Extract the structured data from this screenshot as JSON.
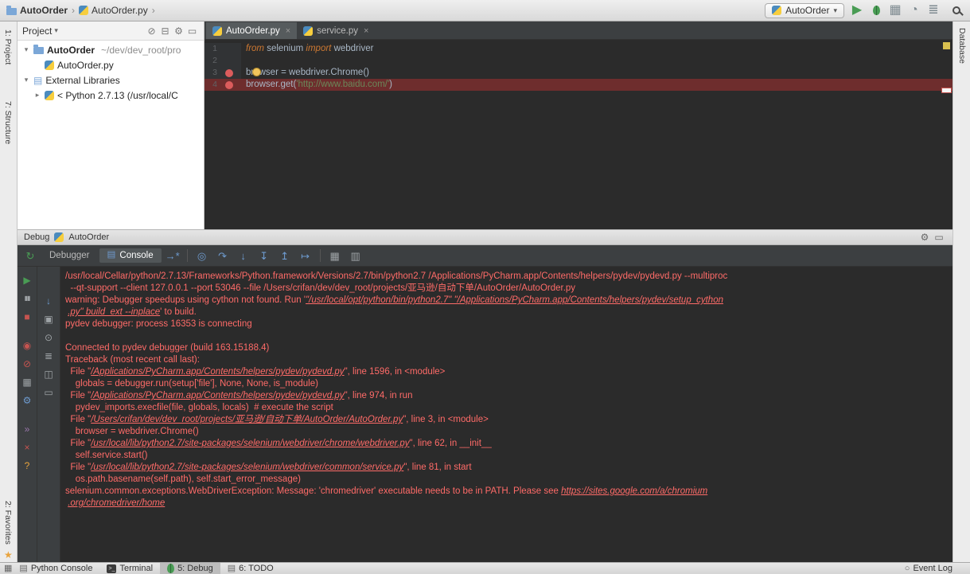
{
  "top_toolbar": {
    "breadcrumb": [
      {
        "label": "AutoOrder",
        "icon": "folder"
      },
      {
        "label": "AutoOrder.py",
        "icon": "python-file"
      }
    ],
    "run_config_label": "AutoOrder",
    "icons": [
      {
        "name": "run-button",
        "glyph": "▶",
        "color": "#499C54"
      },
      {
        "name": "debug-button",
        "glyph": "BUG",
        "color": "#499C54"
      },
      {
        "name": "coverage-button",
        "glyph": "▦",
        "color": "#7f8b91"
      },
      {
        "name": "profiler-button",
        "glyph": "◔",
        "color": "#7f8b91"
      },
      {
        "name": "tool-windows-button",
        "glyph": "≣",
        "color": "#7f8b91"
      }
    ]
  },
  "stripes": {
    "left_top": "1: Project",
    "left_mid": "7: Structure",
    "left_bottom": "2: Favorites",
    "right_top": "Database"
  },
  "project_panel": {
    "title": "Project",
    "header_icons": [
      {
        "name": "locate-icon",
        "glyph": "⊘"
      },
      {
        "name": "collapse-all-icon",
        "glyph": "⊟"
      },
      {
        "name": "settings-icon",
        "glyph": "⚙"
      },
      {
        "name": "hide-icon",
        "glyph": "▭"
      }
    ],
    "tree": [
      {
        "label": "AutoOrder",
        "detail": "~/dev/dev_root/pro",
        "level": 0,
        "expanded": true,
        "icon": "folder",
        "bold": true
      },
      {
        "label": "AutoOrder.py",
        "level": 1,
        "icon": "python-file"
      },
      {
        "label": "External Libraries",
        "level": 0,
        "expanded": true,
        "icon": "libraries"
      },
      {
        "label": "< Python 2.7.13 (/usr/local/C",
        "level": 1,
        "expanded": false,
        "icon": "python"
      }
    ]
  },
  "editor": {
    "tabs": [
      {
        "label": "AutoOrder.py",
        "active": true
      },
      {
        "label": "service.py",
        "active": false
      }
    ],
    "lines": [
      {
        "num": 1,
        "segments": [
          {
            "c": "kw",
            "t": "from"
          },
          {
            "c": "pl",
            "t": " selenium "
          },
          {
            "c": "kw",
            "t": "import"
          },
          {
            "c": "pl",
            "t": " webdriver"
          }
        ]
      },
      {
        "num": 2,
        "segments": []
      },
      {
        "num": 3,
        "breakpoint": true,
        "bulb": true,
        "segments": [
          {
            "c": "pl",
            "t": "browser = webdriver.Chrome()"
          }
        ]
      },
      {
        "num": 4,
        "breakpoint": true,
        "current": true,
        "segments": [
          {
            "c": "pl",
            "t": "browser.get("
          },
          {
            "c": "str",
            "t": "'http://www.baidu.com/'"
          },
          {
            "c": "pl",
            "t": ")"
          }
        ]
      }
    ]
  },
  "debug_panel": {
    "title": "Debug",
    "config_label": "AutoOrder",
    "rerun_icon": {
      "name": "rerun-icon",
      "glyph": "↻",
      "color": "#499C54"
    },
    "tabs": [
      {
        "label": "Debugger",
        "active": false
      },
      {
        "label": "Console",
        "active": true,
        "icon": "▤"
      }
    ],
    "console_options_icon": {
      "name": "console-options-icon",
      "glyph": "→*",
      "color": "#6E9BCF"
    },
    "toolbar_icons": [
      {
        "name": "show-execution-point-icon",
        "glyph": "◎",
        "color": "#6E9BCF"
      },
      {
        "name": "step-over-icon",
        "glyph": "↷",
        "color": "#6E9BCF"
      },
      {
        "name": "step-into-icon",
        "glyph": "↓",
        "color": "#6E9BCF"
      },
      {
        "name": "force-step-into-icon",
        "glyph": "↧",
        "color": "#6E9BCF"
      },
      {
        "name": "step-out-icon",
        "glyph": "↥",
        "color": "#6E9BCF"
      },
      {
        "name": "run-to-cursor-icon",
        "glyph": "↦",
        "color": "#6E9BCF"
      },
      {
        "sep": true
      },
      {
        "name": "evaluate-expression-icon",
        "glyph": "▦",
        "color": "#9ea3a6"
      },
      {
        "name": "layout-settings-icon",
        "glyph": "▥",
        "color": "#9ea3a6"
      }
    ],
    "header_icons": [
      {
        "name": "settings-icon",
        "glyph": "⚙"
      },
      {
        "name": "hide-icon",
        "glyph": "▭"
      }
    ],
    "left_icons_a": [
      {
        "name": "resume-button",
        "glyph": "▶",
        "color": "#499C54"
      },
      {
        "name": "pause-button",
        "glyph": "▮▮",
        "color": "#9ea3a6",
        "small": true
      },
      {
        "name": "stop-button",
        "glyph": "■",
        "color": "#C75450",
        "gap_after": true
      },
      {
        "name": "view-breakpoints-button",
        "glyph": "◉",
        "color": "#C75450"
      },
      {
        "name": "mute-breakpoints-button",
        "glyph": "⊘",
        "color": "#C75450"
      },
      {
        "name": "restore-layout-button",
        "glyph": "▦",
        "color": "#9ea3a6"
      },
      {
        "name": "settings-button",
        "glyph": "⚙",
        "color": "#6E9BCF",
        "gap_after": true
      },
      {
        "name": "attach-button",
        "glyph": "»",
        "color": "#9876AA"
      },
      {
        "name": "close-button",
        "glyph": "×",
        "color": "#C75450"
      },
      {
        "name": "help-button",
        "glyph": "?",
        "color": "#E8A33D"
      }
    ],
    "left_icons_b": [
      {
        "name": "scroll-down-icon",
        "glyph": "↓",
        "color": "#6E9BCF"
      },
      {
        "name": "frames-icon",
        "glyph": "▣",
        "color": "#9ea3a6"
      },
      {
        "name": "pin-icon",
        "glyph": "⊙",
        "color": "#9ea3a6"
      },
      {
        "name": "view-options-icon",
        "glyph": "≣",
        "color": "#9ea3a6"
      },
      {
        "name": "snapshot-icon",
        "glyph": "◫",
        "color": "#9ea3a6"
      },
      {
        "name": "clear-icon",
        "glyph": "▭",
        "color": "#9ea3a6"
      }
    ],
    "console_lines": [
      [
        {
          "t": "/usr/local/Cellar/python/2.7.13/Frameworks/Python.framework/Versions/2.7/bin/python2.7 /Applications/PyCharm.app/Contents/helpers/pydev/pydevd.py --multiproc"
        }
      ],
      [
        {
          "t": "  --qt-support --client 127.0.0.1 --port 53046 --file /Users/crifan/dev/dev_root/projects/亚马逊/自动下单/AutoOrder/AutoOrder.py"
        }
      ],
      [
        {
          "t": "warning: Debugger speedups using cython not found. Run '"
        },
        {
          "t": "\"/usr/local/opt/python/bin/python2.7\" \"/Applications/PyCharm.app/Contents/helpers/pydev/setup_cython",
          "u": true
        }
      ],
      [
        {
          "t": " "
        },
        {
          "t": ".py\" build_ext --inplace",
          "u": true
        },
        {
          "t": "' to build."
        }
      ],
      [
        {
          "t": "pydev debugger: process 16353 is connecting"
        }
      ],
      [],
      [
        {
          "t": "Connected to pydev debugger (build 163.15188.4)"
        }
      ],
      [
        {
          "t": "Traceback (most recent call last):"
        }
      ],
      [
        {
          "t": "  File \""
        },
        {
          "t": "/Applications/PyCharm.app/Contents/helpers/pydev/pydevd.py",
          "u": true
        },
        {
          "t": "\", line 1596, in <module>"
        }
      ],
      [
        {
          "t": "    globals = debugger.run(setup['file'], None, None, is_module)"
        }
      ],
      [
        {
          "t": "  File \""
        },
        {
          "t": "/Applications/PyCharm.app/Contents/helpers/pydev/pydevd.py",
          "u": true
        },
        {
          "t": "\", line 974, in run"
        }
      ],
      [
        {
          "t": "    pydev_imports.execfile(file, globals, locals)  # execute the script"
        }
      ],
      [
        {
          "t": "  File \""
        },
        {
          "t": "/Users/crifan/dev/dev_root/projects/亚马逊/自动下单/AutoOrder/AutoOrder.py",
          "u": true
        },
        {
          "t": "\", line 3, in <module>"
        }
      ],
      [
        {
          "t": "    browser = webdriver.Chrome()"
        }
      ],
      [
        {
          "t": "  File \""
        },
        {
          "t": "/usr/local/lib/python2.7/site-packages/selenium/webdriver/chrome/webdriver.py",
          "u": true
        },
        {
          "t": "\", line 62, in __init__"
        }
      ],
      [
        {
          "t": "    self.service.start()"
        }
      ],
      [
        {
          "t": "  File \""
        },
        {
          "t": "/usr/local/lib/python2.7/site-packages/selenium/webdriver/common/service.py",
          "u": true
        },
        {
          "t": "\", line 81, in start"
        }
      ],
      [
        {
          "t": "    os.path.basename(self.path), self.start_error_message)"
        }
      ],
      [
        {
          "t": "selenium.common.exceptions.WebDriverException: Message: 'chromedriver' executable needs to be in PATH. Please see "
        },
        {
          "t": "https://sites.google.com/a/chromium",
          "u": true
        }
      ],
      [
        {
          "t": " "
        },
        {
          "t": ".org/chromedriver/home",
          "u": true
        }
      ]
    ]
  },
  "bottom_bar": {
    "items": [
      {
        "label": "Python Console",
        "icon": "console"
      },
      {
        "label": "Terminal",
        "icon": "terminal"
      },
      {
        "label": "5: Debug",
        "icon": "bug",
        "active": true
      },
      {
        "label": "6: TODO",
        "icon": "todo"
      }
    ],
    "right_label": "Event Log"
  }
}
